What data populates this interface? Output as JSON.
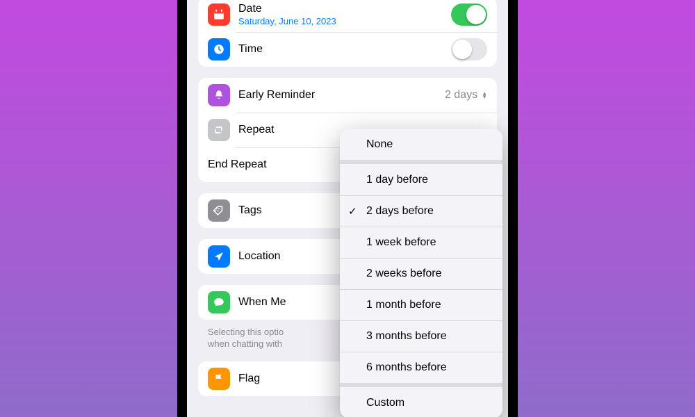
{
  "datetime_card": {
    "date": {
      "label": "Date",
      "value": "Saturday, June 10, 2023",
      "toggle_on": true
    },
    "time": {
      "label": "Time",
      "toggle_on": false
    }
  },
  "reminder_card": {
    "early_reminder": {
      "label": "Early Reminder",
      "value": "2 days"
    },
    "repeat": {
      "label": "Repeat"
    },
    "end_repeat": {
      "label": "End Repeat"
    }
  },
  "tags": {
    "label": "Tags"
  },
  "location": {
    "label": "Location"
  },
  "messaging": {
    "label": "When Me",
    "hint_visible": "Selecting this optio\nwhen chatting with"
  },
  "flag": {
    "label": "Flag"
  },
  "early_reminder_menu": {
    "groups": [
      {
        "items": [
          {
            "label": "None",
            "selected": false
          }
        ]
      },
      {
        "items": [
          {
            "label": "1 day before",
            "selected": false
          },
          {
            "label": "2 days before",
            "selected": true
          },
          {
            "label": "1 week before",
            "selected": false
          },
          {
            "label": "2 weeks before",
            "selected": false
          },
          {
            "label": "1 month before",
            "selected": false
          },
          {
            "label": "3 months before",
            "selected": false
          },
          {
            "label": "6 months before",
            "selected": false
          }
        ]
      },
      {
        "items": [
          {
            "label": "Custom",
            "selected": false
          }
        ]
      }
    ]
  }
}
